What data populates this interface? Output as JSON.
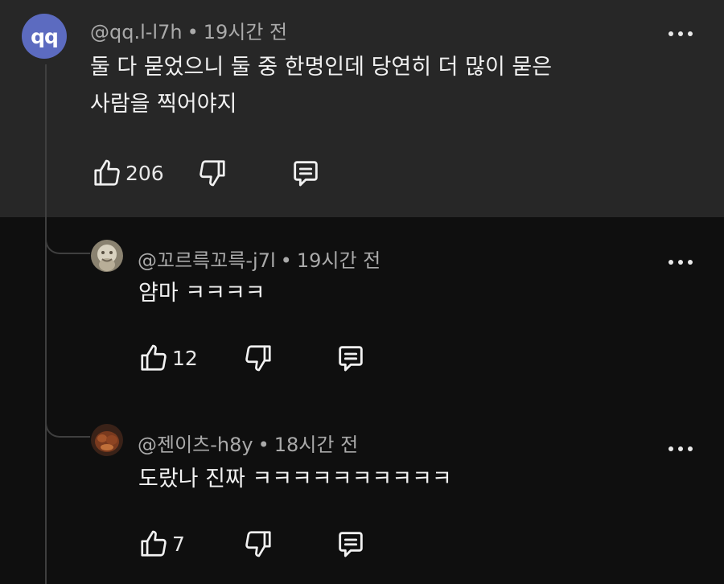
{
  "comments": [
    {
      "avatar_text": "qq",
      "author": "@qq.l-l7h",
      "separator": "•",
      "time": "19시간 전",
      "text_line1": "둘 다 묻었으니 둘 중 한명인데 당연히 더 많이 묻은",
      "text_line2": "사람을 찍어야지",
      "likes": "206"
    },
    {
      "author": "@꼬르륵꼬륵-j7l",
      "separator": "•",
      "time": "19시간 전",
      "text": "얌마 ㅋㅋㅋㅋ",
      "likes": "12"
    },
    {
      "author": "@젠이츠-h8y",
      "separator": "•",
      "time": "18시간 전",
      "text": "도랐나 진짜 ㅋㅋㅋㅋㅋㅋㅋㅋㅋㅋ",
      "likes": "7"
    }
  ],
  "icons": {
    "like": "thumbs-up-icon",
    "dislike": "thumbs-down-icon",
    "reply": "reply-icon",
    "more": "more-options-icon"
  },
  "colors": {
    "background": "#0f0f0f",
    "highlight_background": "#272727",
    "avatar_main": "#5c6bc0",
    "meta_text": "#aaaaaa"
  }
}
